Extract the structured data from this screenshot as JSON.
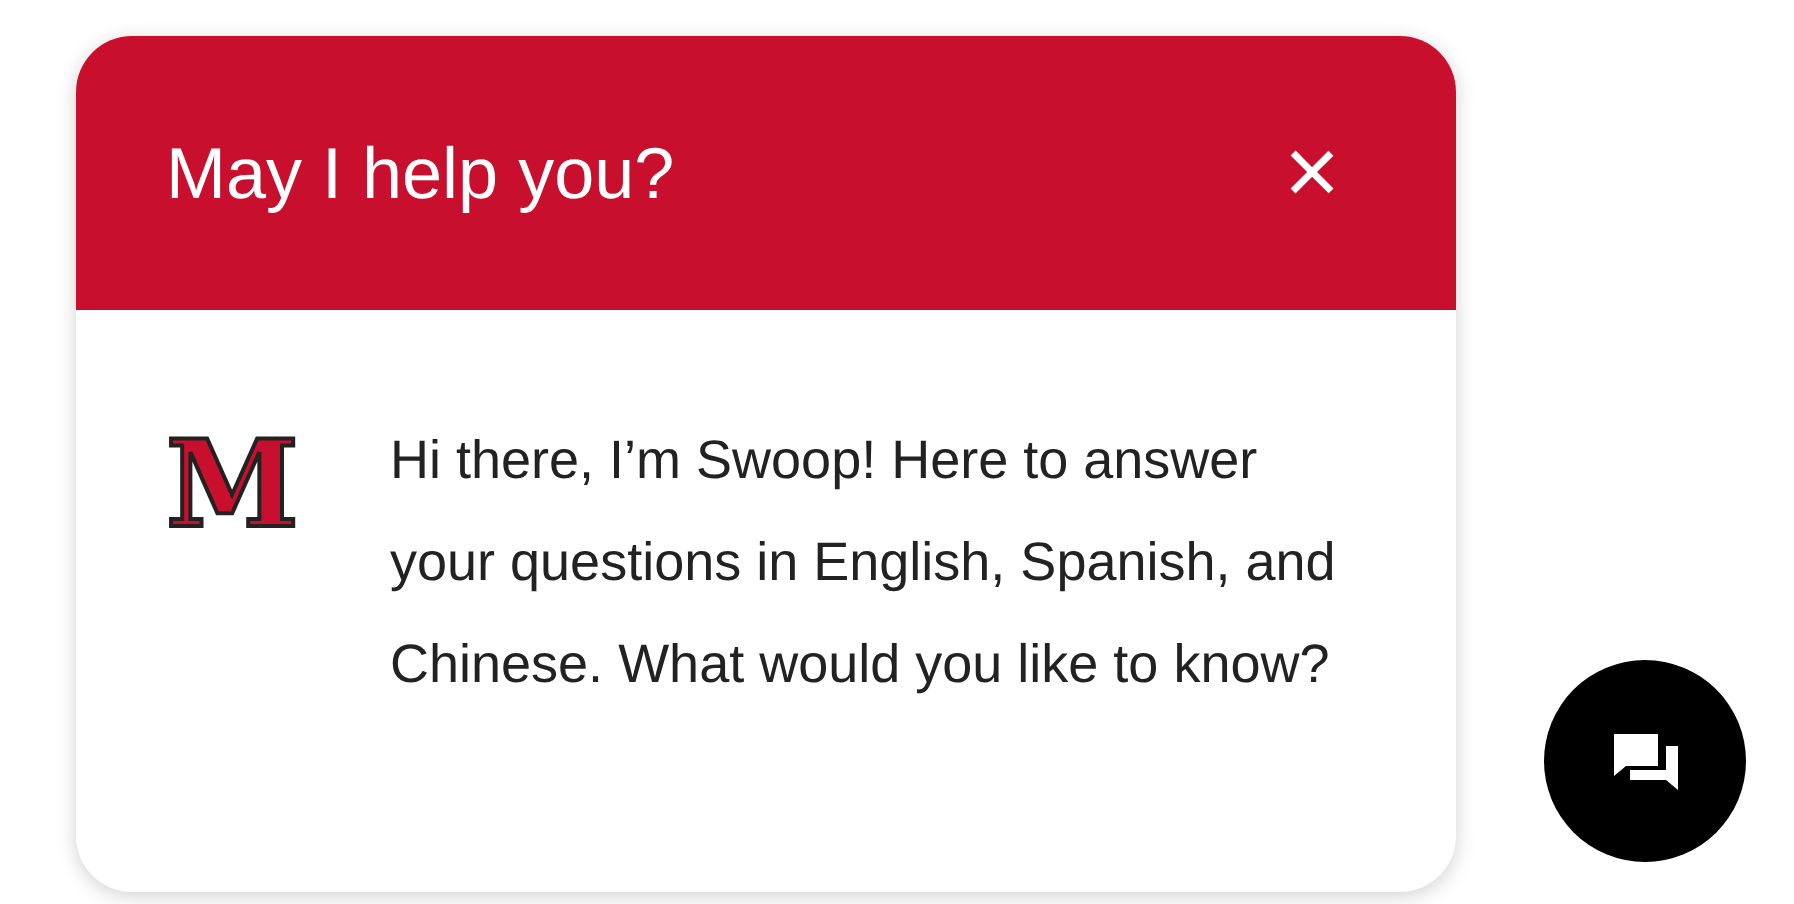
{
  "header": {
    "title": "May I help you?",
    "close": "×"
  },
  "message": {
    "logo_letter": "M",
    "text": "Hi there, I’m Swoop! Here to answer your questions in English, Spanish, and Chinese. What would you like to know?"
  }
}
